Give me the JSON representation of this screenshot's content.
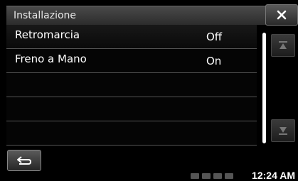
{
  "header": {
    "title": "Installazione"
  },
  "rows": [
    {
      "label": "Retromarcia",
      "value": "Off"
    },
    {
      "label": "Freno a Mano",
      "value": "On"
    },
    {
      "label": "",
      "value": ""
    },
    {
      "label": "",
      "value": ""
    },
    {
      "label": "",
      "value": ""
    }
  ],
  "status": {
    "clock": "12:24 AM"
  },
  "icons": {
    "close": "close-icon",
    "scroll_up": "triangle-up-icon",
    "scroll_down": "triangle-down-icon",
    "back": "return-arrow-icon"
  }
}
